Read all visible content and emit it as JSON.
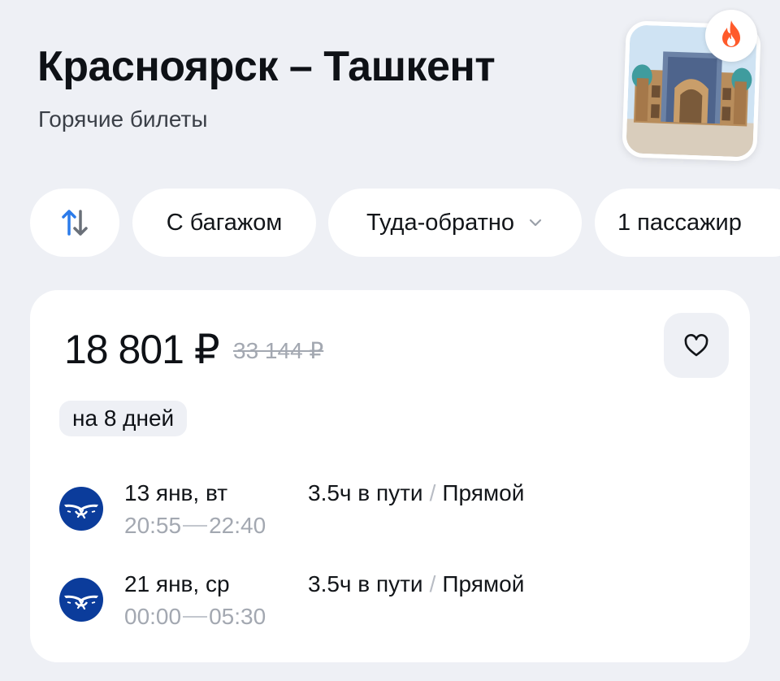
{
  "header": {
    "title": "Красноярск – Ташкент",
    "subtitle": "Горячие билеты",
    "thumbnail_icon": "tashkent-madrasah-photo",
    "badge_icon": "fire-icon"
  },
  "filters": {
    "swap_icon": "swap-arrows-icon",
    "baggage_label": "С багажом",
    "trip_type_label": "Туда-обратно",
    "passengers_label": "1 пассажир"
  },
  "offer": {
    "price": "18 801 ₽",
    "old_price": "33 144 ₽",
    "duration_badge": "на 8 дней",
    "favorite_icon": "heart-outline-icon",
    "legs": [
      {
        "airline_icon": "aeroflot-logo-icon",
        "date": "13 янв, вт",
        "depart": "20:55",
        "arrive": "22:40",
        "travel_time": "3.5ч в пути",
        "separator": "/",
        "stops": "Прямой"
      },
      {
        "airline_icon": "aeroflot-logo-icon",
        "date": "21 янв, ср",
        "depart": "00:00",
        "arrive": "05:30",
        "travel_time": "3.5ч в пути",
        "separator": "/",
        "stops": "Прямой"
      }
    ]
  },
  "colors": {
    "background": "#EEF0F5",
    "card": "#FFFFFF",
    "text": "#0E1116",
    "muted": "#A3A8B1",
    "fire": "#FF5A2A",
    "airline_blue": "#0B3C9B"
  }
}
